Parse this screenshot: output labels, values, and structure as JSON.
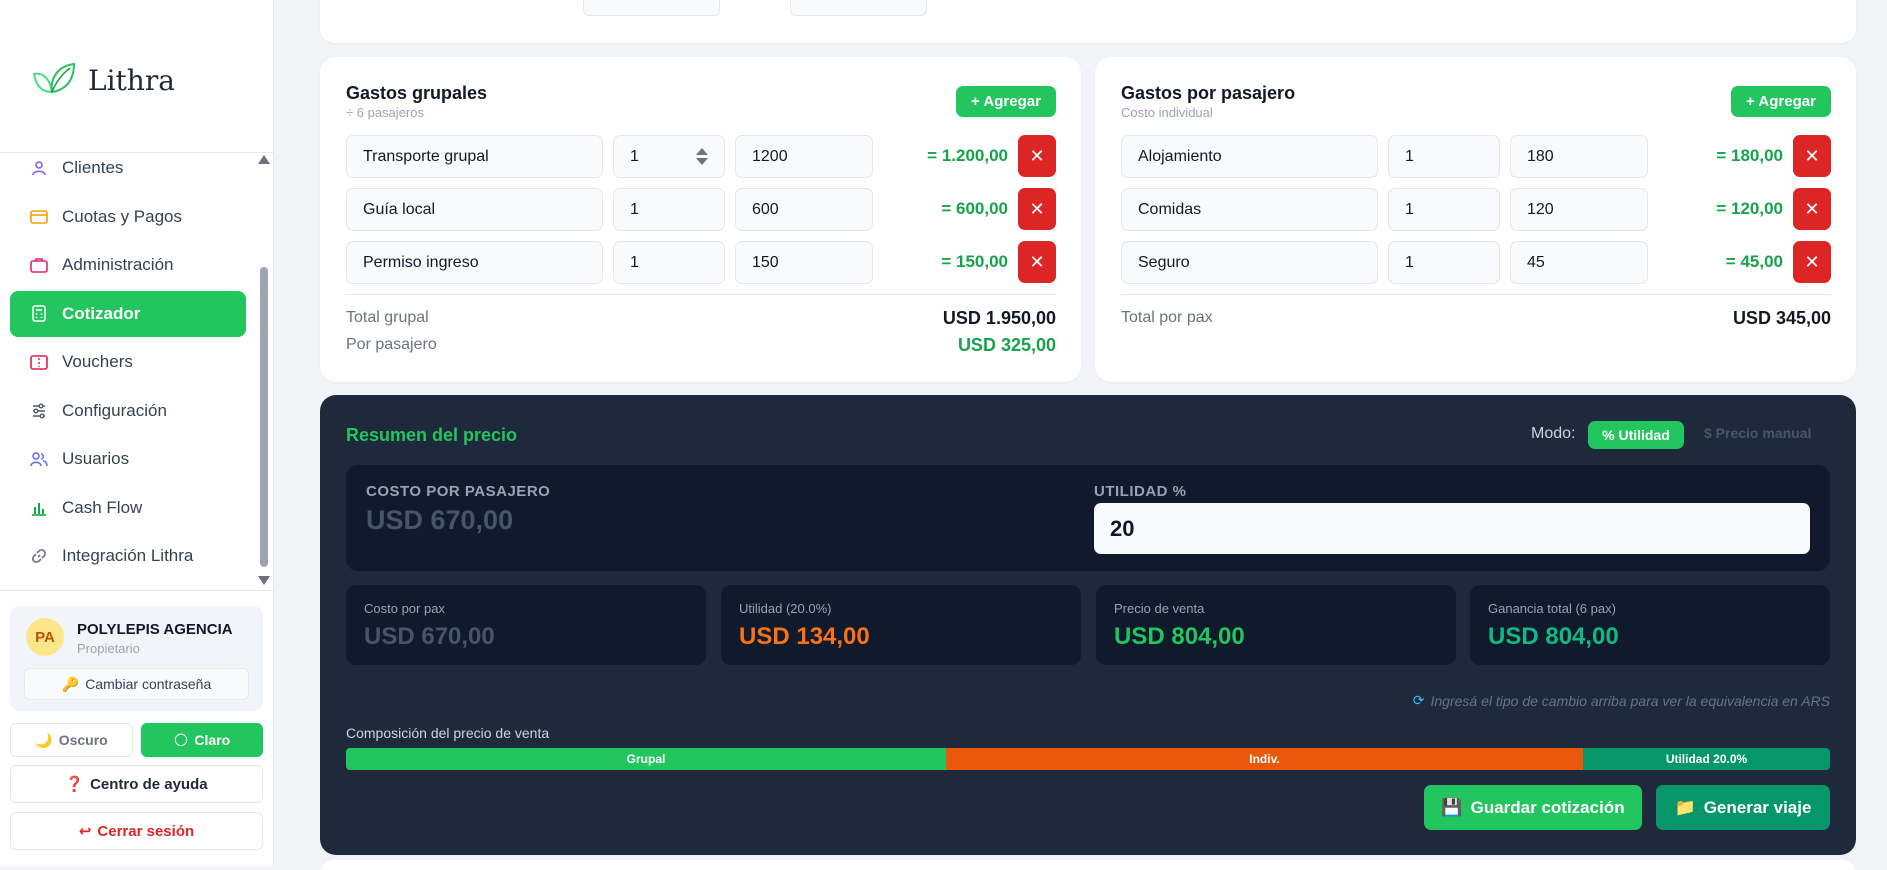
{
  "brand": {
    "name": "Lithra"
  },
  "sidebar": {
    "items": [
      {
        "label": "Clientes",
        "icon": "user-icon",
        "active": false
      },
      {
        "label": "Cuotas y Pagos",
        "icon": "credit-card-icon",
        "active": false
      },
      {
        "label": "Administración",
        "icon": "briefcase-icon",
        "active": false
      },
      {
        "label": "Cotizador",
        "icon": "calculator-icon",
        "active": true
      },
      {
        "label": "Vouchers",
        "icon": "ticket-icon",
        "active": false
      },
      {
        "label": "Configuración",
        "icon": "sliders-icon",
        "active": false
      },
      {
        "label": "Usuarios",
        "icon": "users-icon",
        "active": false
      },
      {
        "label": "Cash Flow",
        "icon": "bar-chart-icon",
        "active": false
      },
      {
        "label": "Integración Lithra",
        "icon": "link-icon",
        "active": false
      }
    ]
  },
  "user": {
    "initials": "PA",
    "name": "POLYLEPIS AGENCIA",
    "role": "Propietario",
    "change_password": "Cambiar contraseña"
  },
  "theme": {
    "dark_label": "Oscuro",
    "light_label": "Claro"
  },
  "footer": {
    "help": "Centro de ayuda",
    "logout": "Cerrar sesión"
  },
  "group_expenses": {
    "title": "Gastos grupales",
    "subtitle": "÷ 6 pasajeros",
    "add_label": "+ Agregar",
    "rows": [
      {
        "name": "Transporte grupal",
        "qty": "1",
        "price": "1200",
        "total": "= 1.200,00"
      },
      {
        "name": "Guía local",
        "qty": "1",
        "price": "600",
        "total": "= 600,00"
      },
      {
        "name": "Permiso ingreso",
        "qty": "1",
        "price": "150",
        "total": "= 150,00"
      }
    ],
    "total_label": "Total grupal",
    "total_value": "USD 1.950,00",
    "per_pax_label": "Por pasajero",
    "per_pax_value": "USD 325,00"
  },
  "pax_expenses": {
    "title": "Gastos por pasajero",
    "subtitle": "Costo individual",
    "add_label": "+ Agregar",
    "rows": [
      {
        "name": "Alojamiento",
        "qty": "1",
        "price": "180",
        "total": "= 180,00"
      },
      {
        "name": "Comidas",
        "qty": "1",
        "price": "120",
        "total": "= 120,00"
      },
      {
        "name": "Seguro",
        "qty": "1",
        "price": "45",
        "total": "= 45,00"
      }
    ],
    "total_label": "Total por pax",
    "total_value": "USD 345,00"
  },
  "summary": {
    "title": "Resumen del precio",
    "mode_label": "Modo:",
    "mode_utility": "% Utilidad",
    "mode_manual": "$ Precio manual",
    "cost_label": "COSTO POR PASAJERO",
    "cost_value": "USD 670,00",
    "utility_label": "UTILIDAD %",
    "utility_value": "20",
    "stats": [
      {
        "label": "Costo por pax",
        "value": "USD 670,00",
        "color": "#475569"
      },
      {
        "label": "Utilidad (20.0%)",
        "value": "USD 134,00",
        "color": "#f97316"
      },
      {
        "label": "Precio de venta",
        "value": "USD 804,00",
        "color": "#22c55e"
      },
      {
        "label": "Ganancia total (6 pax)",
        "value": "USD 804,00",
        "color": "#10b981"
      }
    ],
    "hint": "Ingresá el tipo de cambio arriba para ver la equivalencia en ARS",
    "composition_label": "Composición del precio de venta",
    "composition": [
      {
        "label": "Grupal",
        "fraction": 0.404,
        "color": "#22c55e"
      },
      {
        "label": "Indiv.",
        "fraction": 0.429,
        "color": "#ea580c"
      },
      {
        "label": "Utilidad 20.0%",
        "fraction": 0.167,
        "color": "#059669"
      }
    ],
    "save_label": "Guardar cotización",
    "generate_label": "Generar viaje"
  }
}
